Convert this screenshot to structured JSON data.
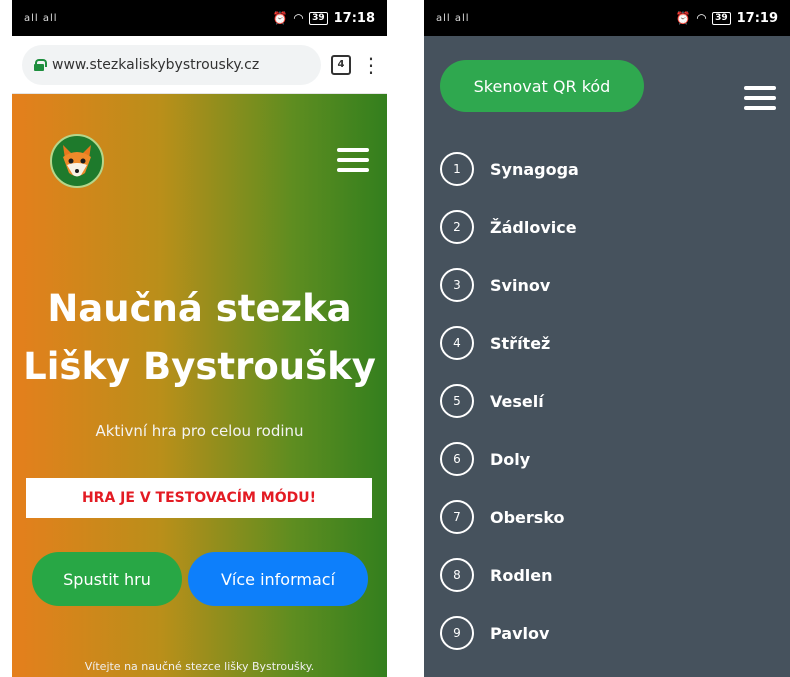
{
  "left": {
    "status": {
      "signal": "all all",
      "time": "17:18",
      "battery": "39"
    },
    "browser": {
      "url": "www.stezkaliskybystrousky.cz",
      "tab_count": "4"
    },
    "hero": {
      "title_line1": "Naučná stezka",
      "title_line2": "Lišky Bystroušky",
      "subtitle": "Aktivní hra pro celou rodinu",
      "test_banner": "HRA JE V TESTOVACÍM MÓDU!",
      "start_button": "Spustit hru",
      "info_button": "Více informací",
      "welcome": "Vítejte na naučné stezce lišky Bystroušky."
    }
  },
  "right": {
    "status": {
      "signal": "all all",
      "time": "17:19",
      "battery": "39"
    },
    "qr_button": "Skenovat QR kód",
    "stops": [
      {
        "num": "1",
        "name": "Synagoga"
      },
      {
        "num": "2",
        "name": "Žádlovice"
      },
      {
        "num": "3",
        "name": "Svinov"
      },
      {
        "num": "4",
        "name": "Střítež"
      },
      {
        "num": "5",
        "name": "Veselí"
      },
      {
        "num": "6",
        "name": "Doly"
      },
      {
        "num": "7",
        "name": "Obersko"
      },
      {
        "num": "8",
        "name": "Rodlen"
      },
      {
        "num": "9",
        "name": "Pavlov"
      }
    ]
  },
  "icons": {
    "lock": "lock-icon",
    "alarm": "alarm-icon",
    "wifi": "wifi-icon",
    "menu": "hamburger-menu-icon",
    "kebab": "more-vert-icon",
    "logo": "fox-logo"
  },
  "colors": {
    "hero_orange": "#e57f1c",
    "hero_green": "#337f1e",
    "green_button": "#28a745",
    "blue_button": "#0d7ffb",
    "panel_dark": "#46525d",
    "warning_red": "#e31b23"
  }
}
